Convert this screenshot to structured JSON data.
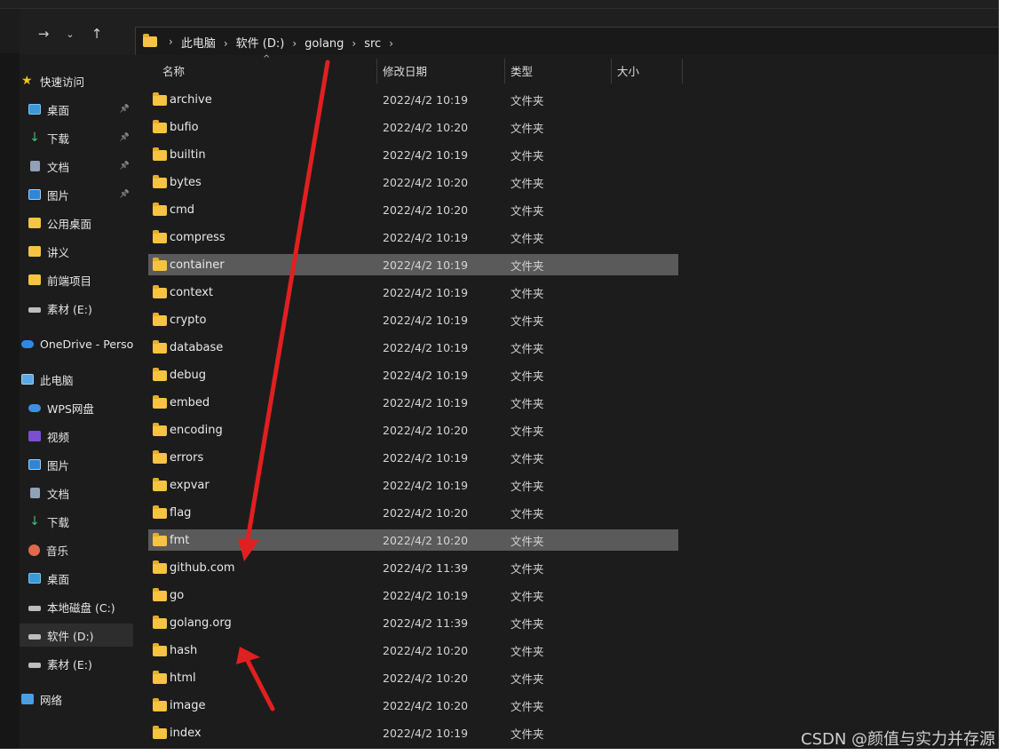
{
  "breadcrumb": [
    "此电脑",
    "软件 (D:)",
    "golang",
    "src"
  ],
  "columns": {
    "name": "名称",
    "modified": "修改日期",
    "type": "类型",
    "size": "大小"
  },
  "nav": {
    "quick_access": "快速访问",
    "quick_items": [
      {
        "label": "桌面",
        "icon": "desktop-icon",
        "pinned": true
      },
      {
        "label": "下载",
        "icon": "download-icon",
        "pinned": true
      },
      {
        "label": "文档",
        "icon": "document-icon",
        "pinned": true
      },
      {
        "label": "图片",
        "icon": "picture-icon",
        "pinned": true
      },
      {
        "label": "公用桌面",
        "icon": "folder-icon",
        "pinned": false
      },
      {
        "label": "讲义",
        "icon": "folder-icon",
        "pinned": false
      },
      {
        "label": "前端项目",
        "icon": "folder-icon",
        "pinned": false
      },
      {
        "label": "素材 (E:)",
        "icon": "drive-icon",
        "pinned": false
      }
    ],
    "onedrive": "OneDrive - Persor",
    "this_pc": "此电脑",
    "pc_items": [
      {
        "label": "WPS网盘",
        "icon": "cloud-icon"
      },
      {
        "label": "视频",
        "icon": "video-icon"
      },
      {
        "label": "图片",
        "icon": "picture-icon"
      },
      {
        "label": "文档",
        "icon": "document-icon"
      },
      {
        "label": "下载",
        "icon": "download-icon"
      },
      {
        "label": "音乐",
        "icon": "music-icon"
      },
      {
        "label": "桌面",
        "icon": "desktop-icon"
      },
      {
        "label": "本地磁盘 (C:)",
        "icon": "drive-icon"
      },
      {
        "label": "软件 (D:)",
        "icon": "drive-icon",
        "selected": true
      },
      {
        "label": "素材 (E:)",
        "icon": "drive-icon"
      }
    ],
    "network": "网络"
  },
  "files": [
    {
      "name": "archive",
      "date": "2022/4/2 10:19",
      "type": "文件夹"
    },
    {
      "name": "bufio",
      "date": "2022/4/2 10:20",
      "type": "文件夹"
    },
    {
      "name": "builtin",
      "date": "2022/4/2 10:19",
      "type": "文件夹"
    },
    {
      "name": "bytes",
      "date": "2022/4/2 10:20",
      "type": "文件夹"
    },
    {
      "name": "cmd",
      "date": "2022/4/2 10:20",
      "type": "文件夹"
    },
    {
      "name": "compress",
      "date": "2022/4/2 10:19",
      "type": "文件夹"
    },
    {
      "name": "container",
      "date": "2022/4/2 10:19",
      "type": "文件夹",
      "highlight": true
    },
    {
      "name": "context",
      "date": "2022/4/2 10:19",
      "type": "文件夹"
    },
    {
      "name": "crypto",
      "date": "2022/4/2 10:19",
      "type": "文件夹"
    },
    {
      "name": "database",
      "date": "2022/4/2 10:19",
      "type": "文件夹"
    },
    {
      "name": "debug",
      "date": "2022/4/2 10:19",
      "type": "文件夹"
    },
    {
      "name": "embed",
      "date": "2022/4/2 10:19",
      "type": "文件夹"
    },
    {
      "name": "encoding",
      "date": "2022/4/2 10:20",
      "type": "文件夹"
    },
    {
      "name": "errors",
      "date": "2022/4/2 10:19",
      "type": "文件夹"
    },
    {
      "name": "expvar",
      "date": "2022/4/2 10:19",
      "type": "文件夹"
    },
    {
      "name": "flag",
      "date": "2022/4/2 10:20",
      "type": "文件夹"
    },
    {
      "name": "fmt",
      "date": "2022/4/2 10:20",
      "type": "文件夹",
      "highlight": true
    },
    {
      "name": "github.com",
      "date": "2022/4/2 11:39",
      "type": "文件夹"
    },
    {
      "name": "go",
      "date": "2022/4/2 10:19",
      "type": "文件夹"
    },
    {
      "name": "golang.org",
      "date": "2022/4/2 11:39",
      "type": "文件夹"
    },
    {
      "name": "hash",
      "date": "2022/4/2 10:20",
      "type": "文件夹"
    },
    {
      "name": "html",
      "date": "2022/4/2 10:20",
      "type": "文件夹"
    },
    {
      "name": "image",
      "date": "2022/4/2 10:20",
      "type": "文件夹"
    },
    {
      "name": "index",
      "date": "2022/4/2 10:19",
      "type": "文件夹"
    }
  ],
  "watermark": "CSDN @颜值与实力并存源",
  "colors": {
    "arrow": "#e02020",
    "folder": "#f6c342",
    "highlight": "#5a5a5a"
  }
}
